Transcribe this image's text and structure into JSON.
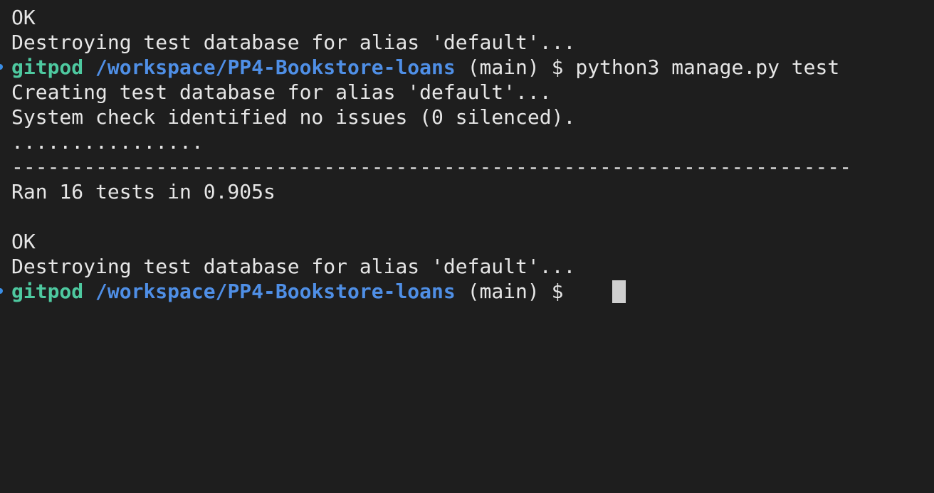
{
  "terminal": {
    "lines": [
      "OK",
      "Destroying test database for alias 'default'..."
    ],
    "prompt1": {
      "user": "gitpod",
      "path": "/workspace/PP4-Bookstore-loans",
      "branch": "(main)",
      "symbol": "$",
      "command": "python3 manage.py test"
    },
    "output": [
      "Creating test database for alias 'default'...",
      "System check identified no issues (0 silenced).",
      "................",
      "----------------------------------------------------------------------",
      "Ran 16 tests in 0.905s",
      "",
      "OK",
      "Destroying test database for alias 'default'..."
    ],
    "prompt2": {
      "user": "gitpod",
      "path": "/workspace/PP4-Bookstore-loans",
      "branch": "(main)",
      "symbol": "$"
    }
  },
  "colors": {
    "background": "#1e1e1e",
    "text": "#e6e6e6",
    "user": "#4ec9a0",
    "path": "#4f8fe6",
    "cursor": "#cfcfcf",
    "marker": "#3a8ee6"
  }
}
